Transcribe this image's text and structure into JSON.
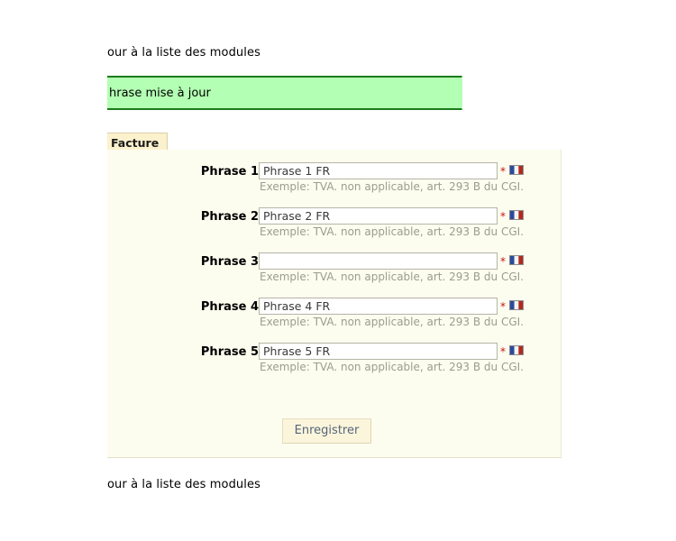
{
  "links": {
    "back_top": "our à la liste des modules",
    "back_bottom": "our à la liste des modules"
  },
  "confirmation": {
    "message": "hrase mise à jour",
    "background_color": "#b3ffb3",
    "border_color": "#1b7a1b"
  },
  "tab": {
    "label": "Facture",
    "background_color": "#fbf1cd"
  },
  "panel": {
    "background_color": "#fdfdef"
  },
  "form": {
    "required_marker": "*",
    "flag_icon_title": "fr-flag-icon",
    "rows": [
      {
        "label": "Phrase 1",
        "value": "Phrase 1 FR",
        "placeholder": "",
        "hint": "Exemple: TVA. non applicable, art. 293 B du CGI."
      },
      {
        "label": "Phrase 2",
        "value": "Phrase 2 FR",
        "placeholder": "",
        "hint": "Exemple: TVA. non applicable, art. 293 B du CGI."
      },
      {
        "label": "Phrase 3",
        "value": "",
        "placeholder": "",
        "hint": "Exemple: TVA. non applicable, art. 293 B du CGI."
      },
      {
        "label": "Phrase 4",
        "value": "Phrase 4 FR",
        "placeholder": "",
        "hint": "Exemple: TVA. non applicable, art. 293 B du CGI."
      },
      {
        "label": "Phrase 5",
        "value": "Phrase 5 FR",
        "placeholder": "",
        "hint": "Exemple: TVA. non applicable, art. 293 B du CGI."
      }
    ]
  },
  "buttons": {
    "save": "Enregistrer"
  },
  "colors": {
    "flag_blue": "#2b4a9b",
    "flag_white": "#f4f4f4",
    "flag_red": "#b02a1e",
    "required_star": "#c81414",
    "hint_text": "#9b9b8f",
    "button_text": "#55667a"
  }
}
